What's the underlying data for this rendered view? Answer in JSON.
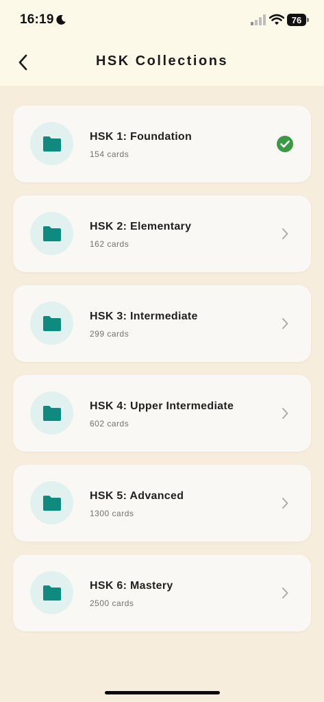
{
  "status_bar": {
    "time": "16:19",
    "battery": "76",
    "icons": [
      "moon-icon",
      "signal-icon",
      "wifi-icon",
      "battery-icon"
    ]
  },
  "header": {
    "title": "HSK Collections",
    "back_icon": "chevron-left-icon"
  },
  "colors": {
    "accent": "#0f8a7e",
    "folder_bg": "#e0f1ef",
    "check": "#3a9a43",
    "page_bg": "#f7eddd",
    "header_bg": "#fdf9e9"
  },
  "collections": [
    {
      "title": "HSK 1: Foundation",
      "subtitle": "154 cards",
      "status_icon": "check-circle-icon",
      "selected": true
    },
    {
      "title": "HSK 2: Elementary",
      "subtitle": "162 cards",
      "status_icon": "chevron-right-icon",
      "selected": false
    },
    {
      "title": "HSK 3: Intermediate",
      "subtitle": "299 cards",
      "status_icon": "chevron-right-icon",
      "selected": false
    },
    {
      "title": "HSK 4: Upper Intermediate",
      "subtitle": "602 cards",
      "status_icon": "chevron-right-icon",
      "selected": false
    },
    {
      "title": "HSK 5: Advanced",
      "subtitle": "1300 cards",
      "status_icon": "chevron-right-icon",
      "selected": false
    },
    {
      "title": "HSK 6: Mastery",
      "subtitle": "2500 cards",
      "status_icon": "chevron-right-icon",
      "selected": false
    }
  ]
}
